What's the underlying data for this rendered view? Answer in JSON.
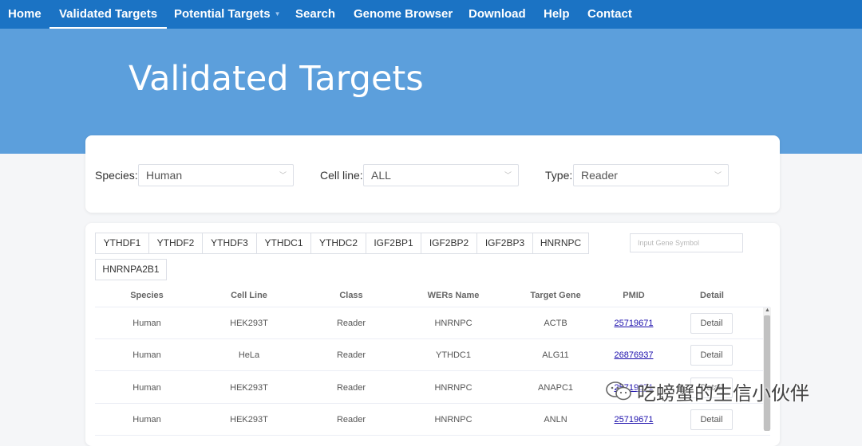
{
  "nav": {
    "items": [
      {
        "label": "Home"
      },
      {
        "label": "Validated Targets"
      },
      {
        "label": "Potential Targets"
      },
      {
        "label": "Search"
      },
      {
        "label": "Genome Browser"
      },
      {
        "label": "Download"
      },
      {
        "label": "Help"
      },
      {
        "label": "Contact"
      }
    ],
    "active": "Validated Targets"
  },
  "hero": {
    "title": "Validated Targets"
  },
  "filters": {
    "species": {
      "label": "Species:",
      "value": "Human"
    },
    "cell_line": {
      "label": "Cell line:",
      "value": "ALL"
    },
    "type": {
      "label": "Type:",
      "value": "Reader"
    }
  },
  "tabs": [
    "YTHDF1",
    "YTHDF2",
    "YTHDF3",
    "YTHDC1",
    "YTHDC2",
    "IGF2BP1",
    "IGF2BP2",
    "IGF2BP3",
    "HNRNPC",
    "HNRNPA2B1"
  ],
  "search": {
    "placeholder": "Input Gene Symbol"
  },
  "table": {
    "columns": [
      "Species",
      "Cell Line",
      "Class",
      "WERs Name",
      "Target Gene",
      "PMID",
      "Detail"
    ],
    "rows": [
      {
        "species": "Human",
        "cell_line": "HEK293T",
        "class": "Reader",
        "wers": "HNRNPC",
        "gene": "ACTB",
        "pmid": "25719671",
        "detail": "Detail"
      },
      {
        "species": "Human",
        "cell_line": "HeLa",
        "class": "Reader",
        "wers": "YTHDC1",
        "gene": "ALG11",
        "pmid": "26876937",
        "detail": "Detail"
      },
      {
        "species": "Human",
        "cell_line": "HEK293T",
        "class": "Reader",
        "wers": "HNRNPC",
        "gene": "ANAPC1",
        "pmid": "25719671",
        "detail": "Detail"
      },
      {
        "species": "Human",
        "cell_line": "HEK293T",
        "class": "Reader",
        "wers": "HNRNPC",
        "gene": "ANLN",
        "pmid": "25719671",
        "detail": "Detail"
      }
    ]
  },
  "watermark": {
    "text": "吃螃蟹的生信小伙伴"
  },
  "colors": {
    "nav": "#1b73c4",
    "hero": "#5c9fdc",
    "link": "#1a0dab"
  }
}
